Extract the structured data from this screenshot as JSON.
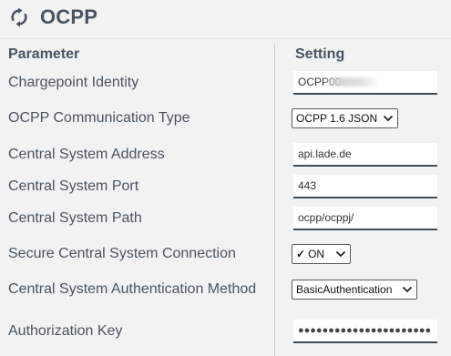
{
  "header": {
    "title": "OCPP",
    "icon": "refresh-icon"
  },
  "columns": {
    "parameter": "Parameter",
    "setting": "Setting"
  },
  "fields": {
    "chargepoint_identity": {
      "label": "Chargepoint Identity",
      "value": "OCPP00"
    },
    "communication_type": {
      "label": "OCPP Communication Type",
      "value": "OCPP 1.6 JSON"
    },
    "central_system_address": {
      "label": "Central System Address",
      "value": "api.lade.de"
    },
    "central_system_port": {
      "label": "Central System Port",
      "value": "443"
    },
    "central_system_path": {
      "label": "Central System Path",
      "value": "ocpp/ocppj/"
    },
    "secure_connection": {
      "label": "Secure Central System Connection",
      "check": "✓",
      "value": "ON"
    },
    "auth_method": {
      "label": "Central System Authentication Method",
      "value": "BasicAuthentication"
    },
    "authorization_key": {
      "label": "Authorization Key",
      "value": "●●●●●●●●●●●●●●●●●●●●●●"
    }
  },
  "colors": {
    "text": "#4a5561",
    "underline": "#3f4d59",
    "background": "#f2f2f2"
  }
}
